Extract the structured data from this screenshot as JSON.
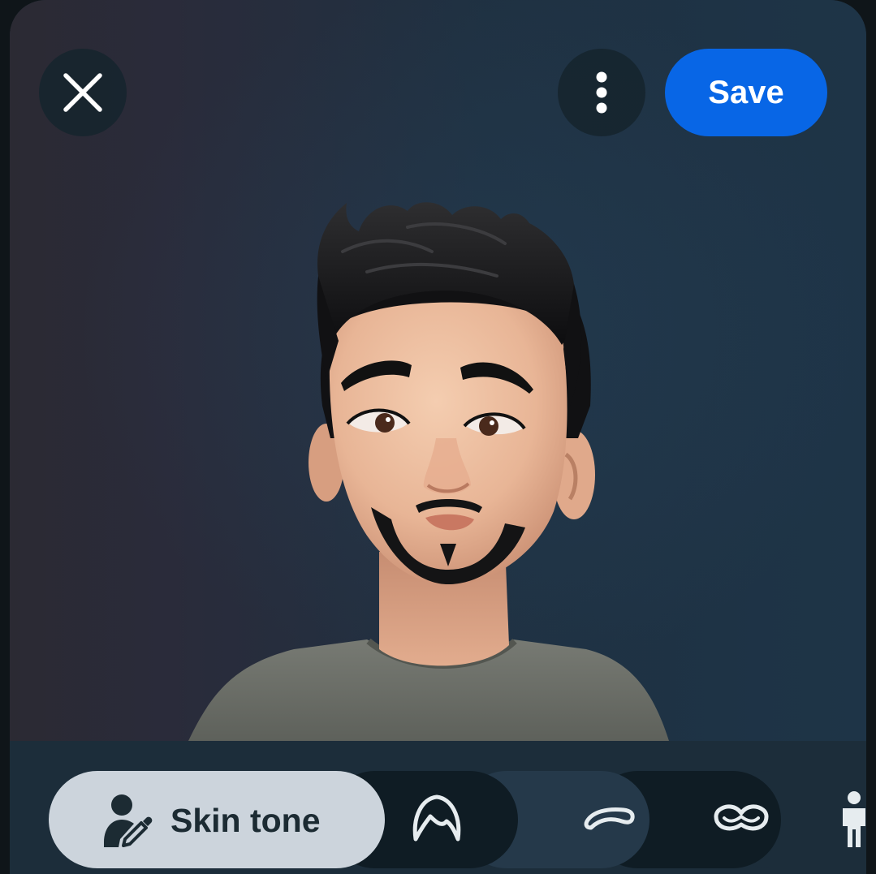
{
  "header": {
    "close_icon": "close-icon",
    "more_icon": "more-vertical-icon",
    "save_label": "Save"
  },
  "tabs": [
    {
      "id": "skin-tone",
      "label": "Skin tone",
      "icon": "person-eyedropper-icon",
      "selected": true
    },
    {
      "id": "hair",
      "label": "",
      "icon": "hair-icon",
      "selected": false
    },
    {
      "id": "eyebrows",
      "label": "",
      "icon": "eyebrow-icon",
      "selected": false
    },
    {
      "id": "facial-hair",
      "label": "",
      "icon": "mustache-icon",
      "selected": false
    },
    {
      "id": "body",
      "label": "",
      "icon": "body-icon",
      "selected": false
    }
  ],
  "colors": {
    "accent": "#0866e6",
    "selected_tab": "#ccd4dc",
    "background": "#1c2d3a"
  }
}
